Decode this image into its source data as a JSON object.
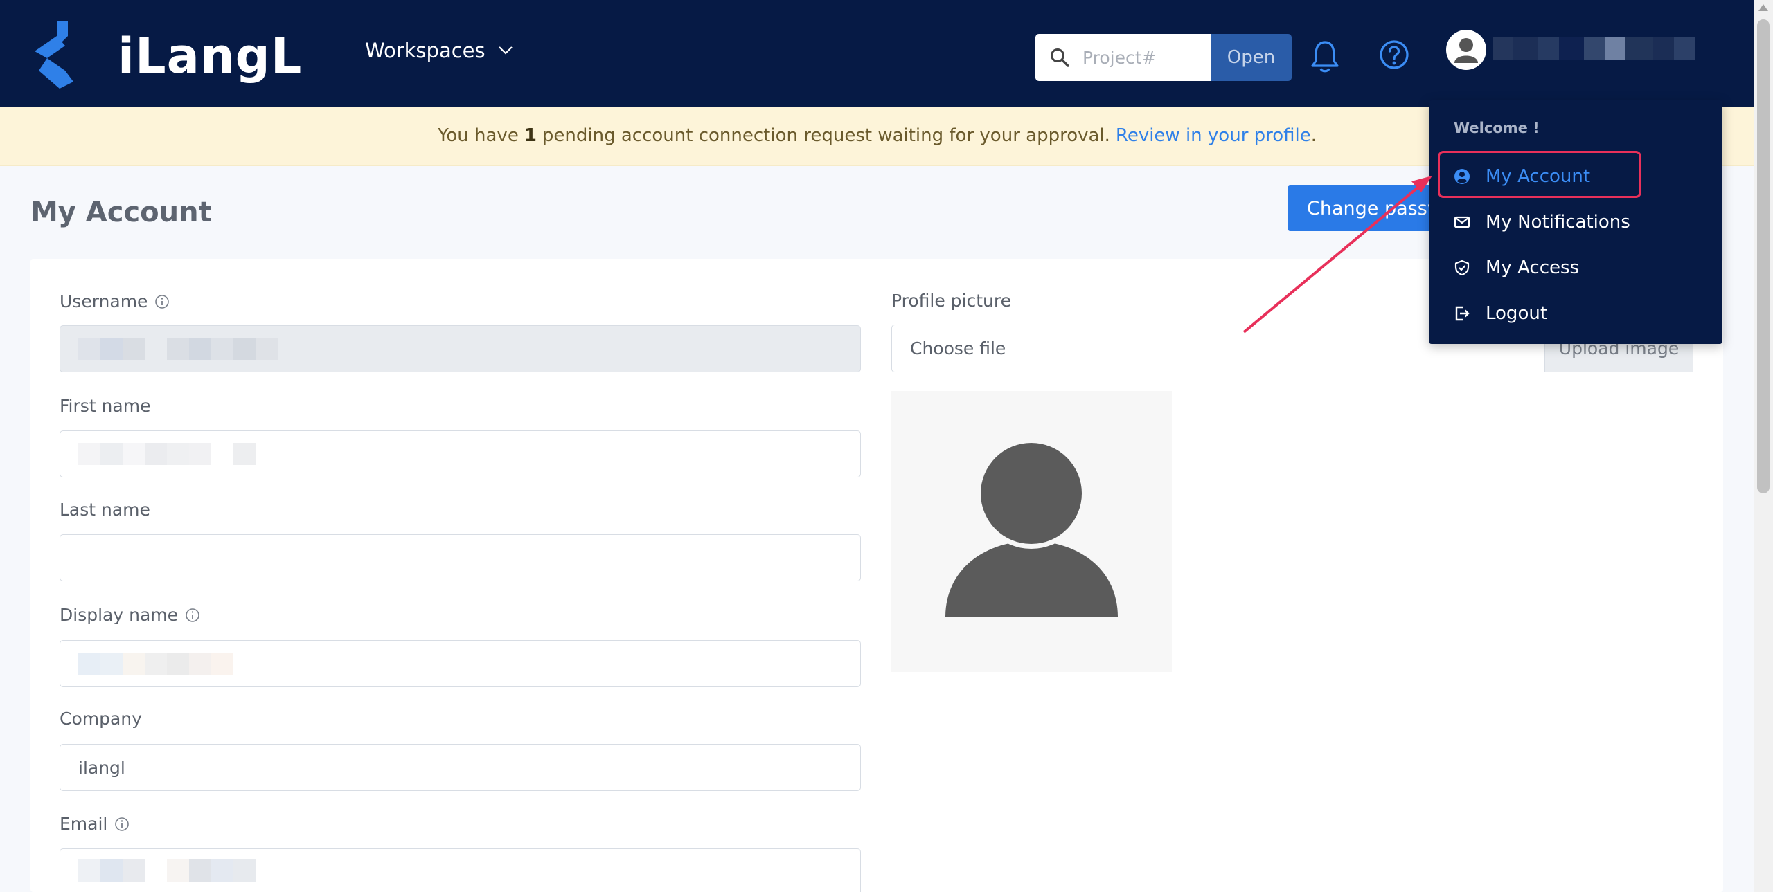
{
  "brand": {
    "name": "iLangL"
  },
  "nav": {
    "workspaces_label": "Workspaces",
    "search_placeholder": "Project#",
    "open_label": "Open"
  },
  "banner": {
    "prefix": "You have",
    "count": "1",
    "middle": "pending account connection request waiting for your approval.",
    "link": "Review in your profile",
    "suffix": "."
  },
  "page": {
    "title": "My Account",
    "change_password_label": "Change password"
  },
  "form": {
    "username_label": "Username",
    "first_name_label": "First name",
    "last_name_label": "Last name",
    "last_name_value": "",
    "display_name_label": "Display name",
    "company_label": "Company",
    "company_value": "ilangl",
    "email_label": "Email",
    "profile_picture_label": "Profile picture",
    "choose_file_label": "Choose file",
    "upload_label": "Upload image"
  },
  "user_menu": {
    "welcome": "Welcome !",
    "items": [
      {
        "label": "My Account",
        "icon": "user-circle-icon",
        "active": true
      },
      {
        "label": "My Notifications",
        "icon": "envelope-icon",
        "active": false
      },
      {
        "label": "My Access",
        "icon": "shield-check-icon",
        "active": false
      },
      {
        "label": "Logout",
        "icon": "logout-icon",
        "active": false
      }
    ]
  },
  "colors": {
    "navbar": "#061a45",
    "primary": "#2a7ae7",
    "banner_bg": "#fdf4d9",
    "link": "#2f80e8",
    "highlight_annotation": "#e8305a"
  }
}
